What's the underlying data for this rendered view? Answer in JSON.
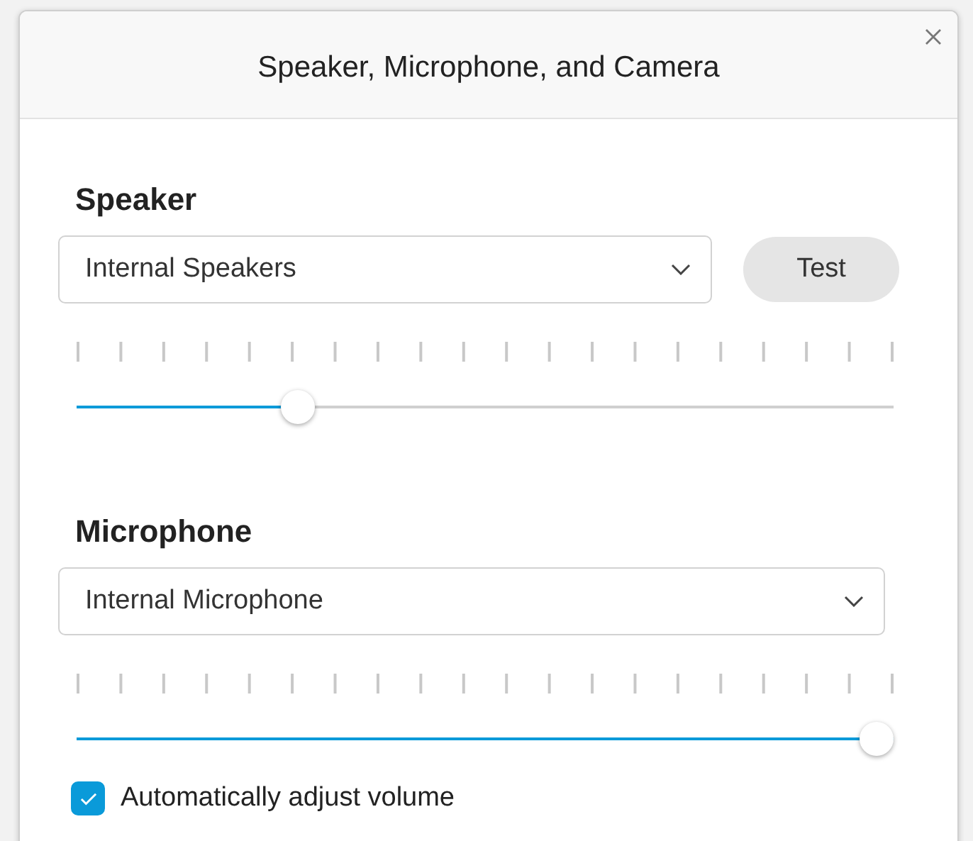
{
  "window": {
    "title": "Speaker, Microphone, and Camera"
  },
  "speaker": {
    "label": "Speaker",
    "device": "Internal Speakers",
    "test_button": "Test",
    "level": 0.26
  },
  "microphone": {
    "label": "Microphone",
    "device": "Internal Microphone",
    "level": 1
  },
  "auto_adjust": {
    "label": "Automatically adjust volume",
    "checked": true
  }
}
